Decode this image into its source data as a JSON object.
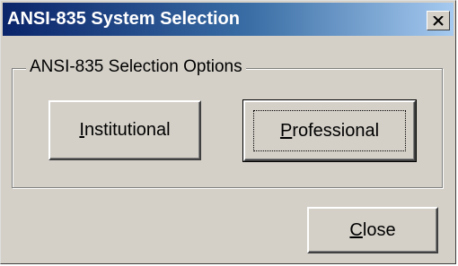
{
  "window": {
    "title": "ANSI-835 System Selection",
    "close_icon": "close-x-icon"
  },
  "group": {
    "legend": "ANSI-835 Selection Options"
  },
  "buttons": {
    "institutional": "Institutional",
    "professional": "Professional",
    "close": "Close"
  },
  "colors": {
    "titlebar_start": "#0a246a",
    "titlebar_end": "#a6caf0",
    "face": "#d4d0c8"
  }
}
